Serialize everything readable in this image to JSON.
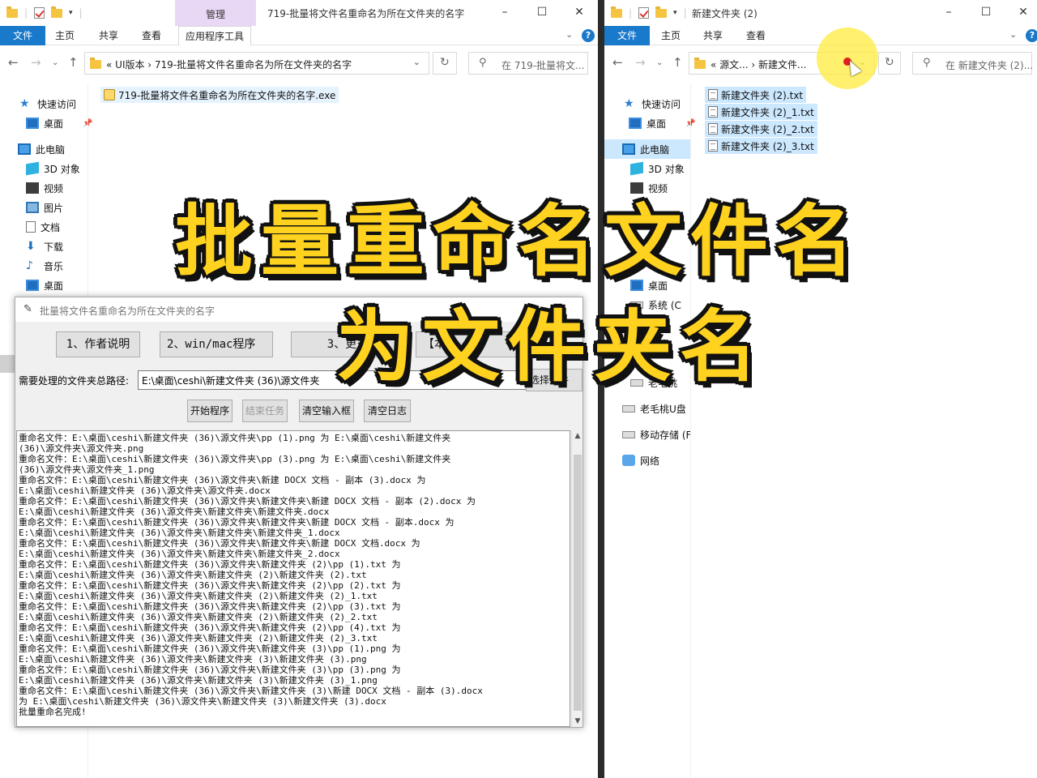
{
  "left_window": {
    "title": "719-批量将文件名重命名为所在文件夹的名字",
    "manage_tab": "管理",
    "ribbon_tabs": [
      "文件",
      "主页",
      "共享",
      "查看",
      "应用程序工具"
    ],
    "breadcrumb": "«  UI版本  ›  719-批量将文件名重命名为所在文件夹的名字",
    "search_placeholder": "在 719-批量将文...",
    "nav_items": [
      "快速访问",
      "桌面",
      "此电脑",
      "3D 对象",
      "视频",
      "图片",
      "文档",
      "下载",
      "音乐",
      "桌面"
    ],
    "files": [
      "719-批量将文件名重命名为所在文件夹的名字.exe"
    ]
  },
  "right_window": {
    "title": "新建文件夹 (2)",
    "ribbon_tabs": [
      "文件",
      "主页",
      "共享",
      "查看"
    ],
    "breadcrumb": "«  源文...  ›  新建文件...",
    "search_placeholder": "在 新建文件夹 (2)...",
    "nav_items": [
      "快速访问",
      "桌面",
      "此电脑",
      "3D 对象",
      "视频",
      "",
      "",
      "桌面",
      "系统 (C",
      "软件",
      "文档",
      "",
      "老毛桃",
      "老毛桃U盘",
      "移动存储 (F",
      "网络"
    ],
    "files": [
      "新建文件夹 (2).txt",
      "新建文件夹 (2)_1.txt",
      "新建文件夹 (2)_2.txt",
      "新建文件夹 (2)_3.txt"
    ]
  },
  "app": {
    "title": "批量将文件名重命名为所在文件夹的名字",
    "top_buttons": [
      "1、作者说明",
      "2、win/mac程序",
      "3、更多",
      "【本"
    ],
    "path_label": "需要处理的文件夹总路径:",
    "path_value": "E:\\桌面\\ceshi\\新建文件夹 (36)\\源文件夹",
    "select_button": "选择文件",
    "action_buttons": [
      "开始程序",
      "结束任务",
      "清空输入框",
      "清空日志"
    ],
    "log": [
      "重命名文件：E:\\桌面\\ceshi\\新建文件夹 (36)\\源文件夹\\pp (1).png 为 E:\\桌面\\ceshi\\新建文件夹",
      "(36)\\源文件夹\\源文件夹.png",
      "重命名文件：E:\\桌面\\ceshi\\新建文件夹 (36)\\源文件夹\\pp (3).png 为 E:\\桌面\\ceshi\\新建文件夹",
      "(36)\\源文件夹\\源文件夹_1.png",
      "重命名文件：E:\\桌面\\ceshi\\新建文件夹 (36)\\源文件夹\\新建 DOCX 文档 - 副本 (3).docx 为",
      "E:\\桌面\\ceshi\\新建文件夹 (36)\\源文件夹\\源文件夹.docx",
      "重命名文件：E:\\桌面\\ceshi\\新建文件夹 (36)\\源文件夹\\新建文件夹\\新建 DOCX 文档 - 副本 (2).docx 为",
      "E:\\桌面\\ceshi\\新建文件夹 (36)\\源文件夹\\新建文件夹\\新建文件夹.docx",
      "重命名文件：E:\\桌面\\ceshi\\新建文件夹 (36)\\源文件夹\\新建文件夹\\新建 DOCX 文档 - 副本.docx 为",
      "E:\\桌面\\ceshi\\新建文件夹 (36)\\源文件夹\\新建文件夹\\新建文件夹_1.docx",
      "重命名文件：E:\\桌面\\ceshi\\新建文件夹 (36)\\源文件夹\\新建文件夹\\新建 DOCX 文档.docx 为",
      "E:\\桌面\\ceshi\\新建文件夹 (36)\\源文件夹\\新建文件夹\\新建文件夹_2.docx",
      "重命名文件：E:\\桌面\\ceshi\\新建文件夹 (36)\\源文件夹\\新建文件夹 (2)\\pp (1).txt 为",
      "E:\\桌面\\ceshi\\新建文件夹 (36)\\源文件夹\\新建文件夹 (2)\\新建文件夹 (2).txt",
      "重命名文件：E:\\桌面\\ceshi\\新建文件夹 (36)\\源文件夹\\新建文件夹 (2)\\pp (2).txt 为",
      "E:\\桌面\\ceshi\\新建文件夹 (36)\\源文件夹\\新建文件夹 (2)\\新建文件夹 (2)_1.txt",
      "重命名文件：E:\\桌面\\ceshi\\新建文件夹 (36)\\源文件夹\\新建文件夹 (2)\\pp (3).txt 为",
      "E:\\桌面\\ceshi\\新建文件夹 (36)\\源文件夹\\新建文件夹 (2)\\新建文件夹 (2)_2.txt",
      "重命名文件：E:\\桌面\\ceshi\\新建文件夹 (36)\\源文件夹\\新建文件夹 (2)\\pp (4).txt 为",
      "E:\\桌面\\ceshi\\新建文件夹 (36)\\源文件夹\\新建文件夹 (2)\\新建文件夹 (2)_3.txt",
      "重命名文件：E:\\桌面\\ceshi\\新建文件夹 (36)\\源文件夹\\新建文件夹 (3)\\pp (1).png 为",
      "E:\\桌面\\ceshi\\新建文件夹 (36)\\源文件夹\\新建文件夹 (3)\\新建文件夹 (3).png",
      "重命名文件：E:\\桌面\\ceshi\\新建文件夹 (36)\\源文件夹\\新建文件夹 (3)\\pp (3).png 为",
      "E:\\桌面\\ceshi\\新建文件夹 (36)\\源文件夹\\新建文件夹 (3)\\新建文件夹 (3)_1.png",
      "重命名文件：E:\\桌面\\ceshi\\新建文件夹 (36)\\源文件夹\\新建文件夹 (3)\\新建 DOCX 文档 - 副本 (3).docx",
      "为 E:\\桌面\\ceshi\\新建文件夹 (36)\\源文件夹\\新建文件夹 (3)\\新建文件夹 (3).docx",
      "批量重命名完成!"
    ]
  },
  "overlay": {
    "line1": "批量重命名文件名",
    "line2": "为文件夹名",
    "color": "#ffd21f"
  }
}
